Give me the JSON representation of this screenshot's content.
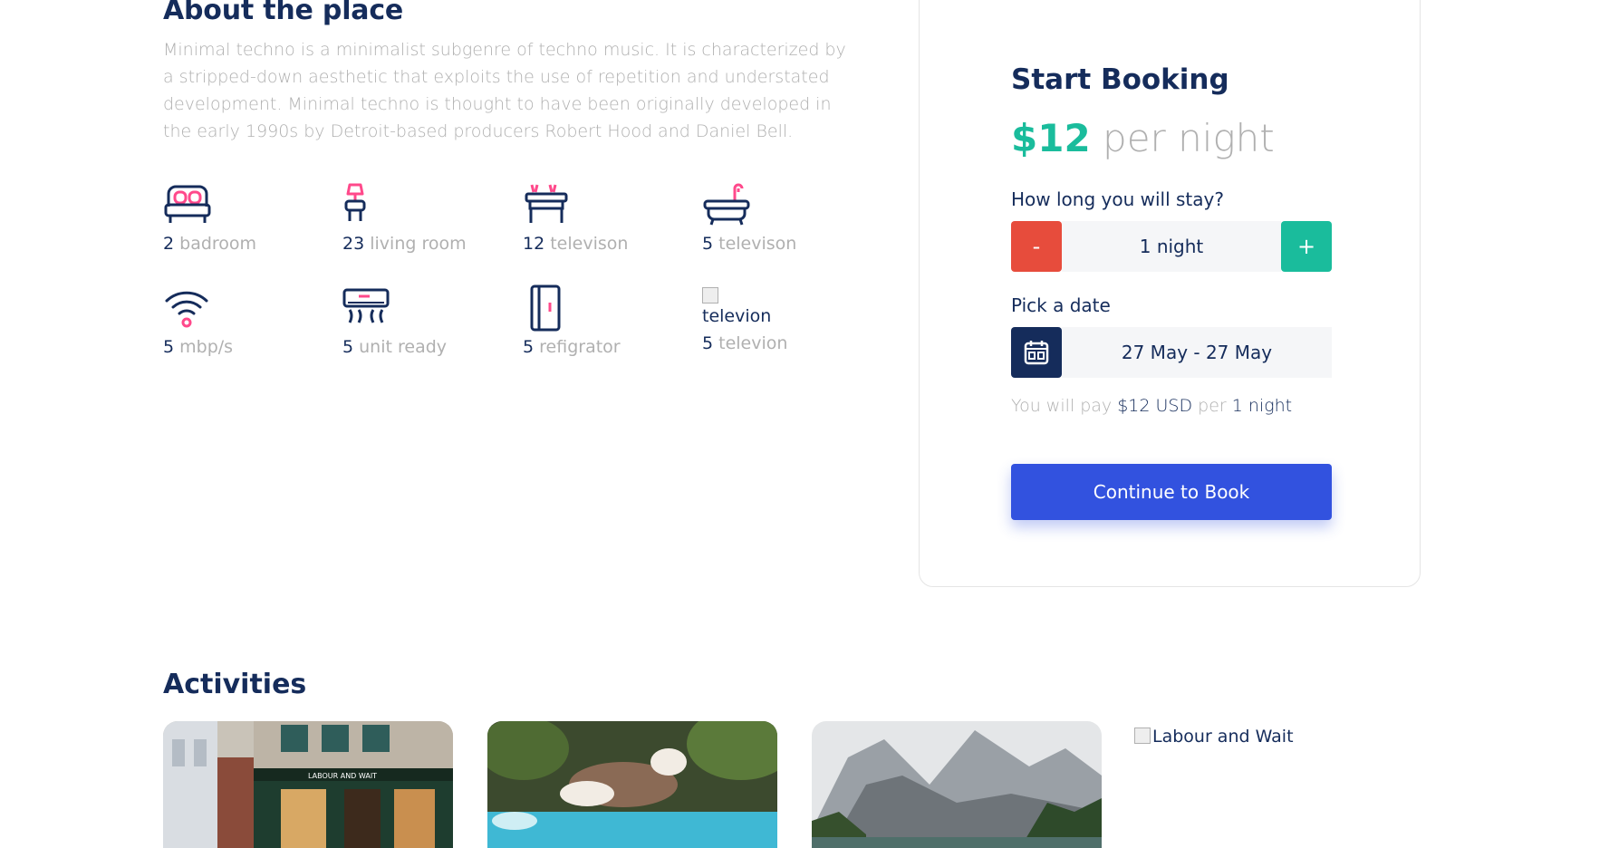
{
  "about": {
    "title": "About the place",
    "description": "Minimal techno is a minimalist subgenre of techno music. It is characterized by a stripped-down aesthetic that exploits the use of repetition and understated development. Minimal techno is thought to have been originally developed in the early 1990s by Detroit-based producers Robert Hood and Daniel Bell."
  },
  "amenities": [
    {
      "count": "2",
      "label": "badroom",
      "icon": "bed-icon"
    },
    {
      "count": "23",
      "label": "living room",
      "icon": "living-room-icon"
    },
    {
      "count": "12",
      "label": "televison",
      "icon": "table-icon"
    },
    {
      "count": "5",
      "label": "televison",
      "icon": "bathtub-icon"
    },
    {
      "count": "5",
      "label": "mbp/s",
      "icon": "wifi-icon"
    },
    {
      "count": "5",
      "label": "unit ready",
      "icon": "air-conditioner-icon"
    },
    {
      "count": "5",
      "label": "refigrator",
      "icon": "refrigerator-icon"
    },
    {
      "count": "5",
      "label": "televion",
      "icon": "broken-image",
      "alt": "televion"
    }
  ],
  "booking": {
    "title": "Start Booking",
    "price": "$12",
    "per_night": "per night",
    "stay_label": "How long you will stay?",
    "minus_label": "-",
    "plus_label": "+",
    "duration_value": "1 night",
    "date_label": "Pick a date",
    "date_value": "27 May - 27 May",
    "pay_prefix": "You will pay",
    "pay_amount": "$12 USD",
    "pay_per": "per",
    "pay_duration": "1 night",
    "continue_label": "Continue to Book",
    "colors": {
      "price": "#1abc9c",
      "minus": "#e74c3c",
      "plus": "#1abc9c",
      "primary": "#3252df",
      "navy": "#152c5b"
    }
  },
  "activities": {
    "title": "Activities",
    "items": [
      {
        "kind": "storefront-photo",
        "alt": "Labour and Wait storefront",
        "sign": "LABOUR AND WAIT"
      },
      {
        "kind": "dog-pool-photo",
        "alt": "Dog jumping in pool"
      },
      {
        "kind": "mountain-lake-photo",
        "alt": "Mountain lake"
      },
      {
        "kind": "broken-image",
        "alt": "Labour and Wait"
      }
    ]
  }
}
